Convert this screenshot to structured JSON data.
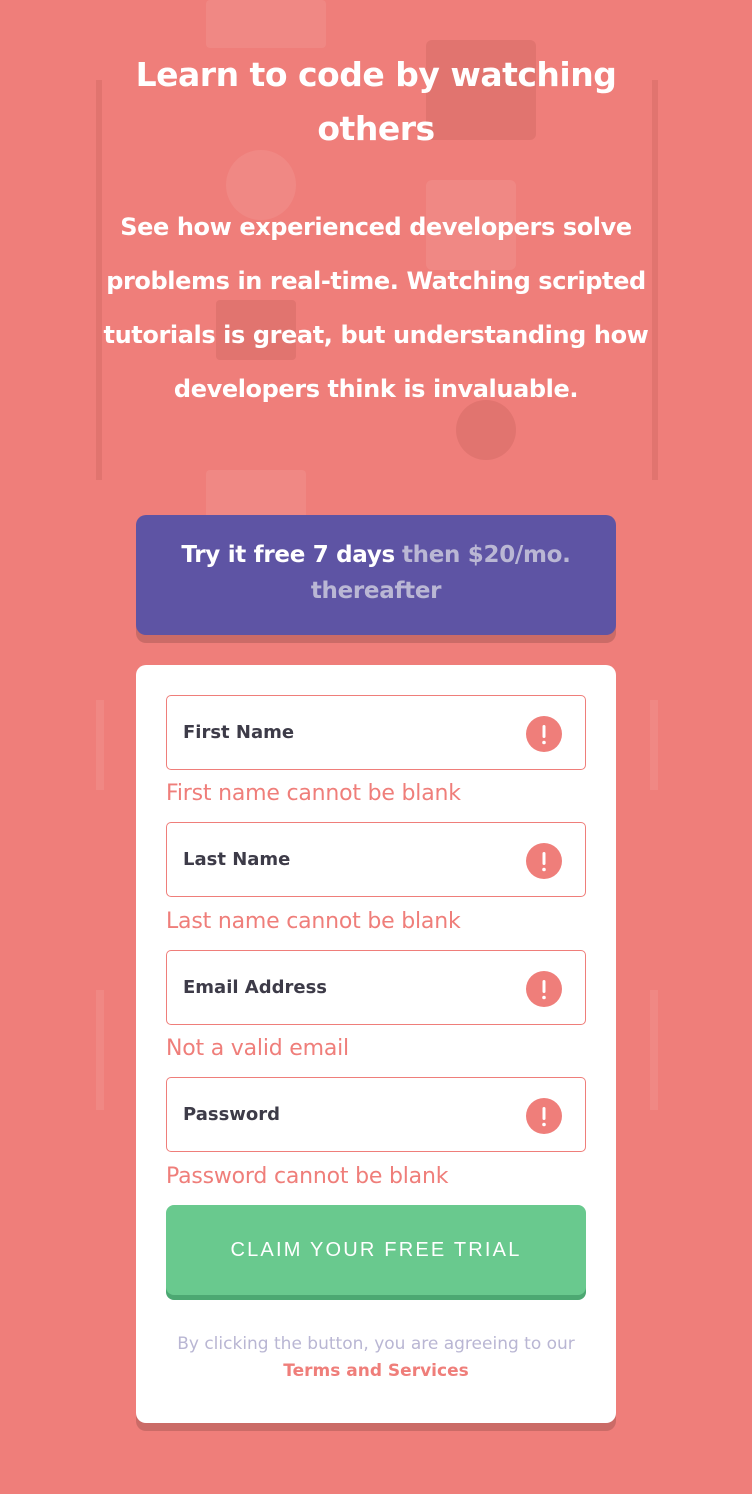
{
  "hero": {
    "headline": "Learn to code by watching others",
    "description": "See how experienced developers solve problems in real-time. Watching scripted tutorials is great, but understanding how developers think is invaluable."
  },
  "offer": {
    "highlight": "Try it free 7 days",
    "rest": "then $20/mo. thereafter"
  },
  "form": {
    "fields": [
      {
        "placeholder": "First Name",
        "value": "",
        "error": "First name cannot be blank",
        "icon": "error-icon"
      },
      {
        "placeholder": "Last Name",
        "value": "",
        "error": "Last name cannot be blank",
        "icon": "error-icon"
      },
      {
        "placeholder": "Email Address",
        "value": "",
        "error": "Not a valid email",
        "icon": "error-icon"
      },
      {
        "placeholder": "Password",
        "value": "",
        "error": "Password cannot be blank",
        "icon": "error-icon"
      }
    ],
    "submit_label": "CLAIM YOUR FREE TRIAL",
    "terms_prefix": "By clicking the button, you are agreeing to our",
    "terms_link": "Terms and Services"
  },
  "colors": {
    "background": "#ef7e7a",
    "offer_bg": "#5e54a4",
    "submit_bg": "#69c98e",
    "error": "#ef7e7a",
    "text_dark": "#3d3b48",
    "muted": "#b9b6d3"
  }
}
